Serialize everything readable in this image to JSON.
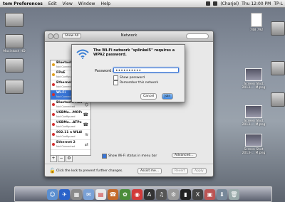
{
  "menubar": {
    "app": "tem Preferences",
    "items": [
      "Edit",
      "View",
      "Window",
      "Help"
    ],
    "user": "(Charjel)",
    "clock": "Thu 12:00 PM",
    "network_name": "TP-L"
  },
  "desktop": {
    "left_icons": [
      "Macintosh HD"
    ],
    "right_icons": [
      "748 792",
      "Screen Shot 2013-... M.png",
      "Screen Shot 2013-... M.png",
      "Screen Shot 2013-... M.png"
    ]
  },
  "window": {
    "title": "Network",
    "show_all": "Show All",
    "services": [
      {
        "name": "Bluetooth DUN",
        "status": "Not Connected",
        "color": "#e0a020"
      },
      {
        "name": "FPoE",
        "status": "Not Configured",
        "color": "#e0a020"
      },
      {
        "name": "Ethernet 1",
        "status": "Not Connected",
        "color": "#d33030"
      },
      {
        "name": "Wi-Fi",
        "status": "Not Connected",
        "color": "#d33030"
      },
      {
        "name": "Bluetooth PAN",
        "status": "Not Connected",
        "color": "#d33030"
      },
      {
        "name": "USBMo...MOPort",
        "status": "Not Configured",
        "color": "#d33030"
      },
      {
        "name": "USBMo...ATPort",
        "status": "Not Configured",
        "color": "#d33030"
      },
      {
        "name": "802.11 n WLAN",
        "status": "Not Configured",
        "color": "#d33030"
      },
      {
        "name": "Ethernet 2",
        "status": "Not Connected",
        "color": "#d33030"
      }
    ],
    "wifi_off_label": "n Off",
    "show_wifi_status": "Show Wi-Fi status in menu bar",
    "advanced": "Advanced...",
    "lock_text": "Click the lock to prevent further changes.",
    "assist": "Assist me...",
    "revert": "Revert",
    "apply": "Apply",
    "tool_add": "+",
    "tool_remove": "−",
    "tool_gear": "⚙"
  },
  "sheet": {
    "message": "The Wi-Fi network \"splinkel5\" requires a WPA2 password.",
    "password_label": "Password:",
    "password_value": "••••••••••",
    "show_password": "Show password",
    "remember": "Remember this network",
    "cancel": "Cancel",
    "join": "Join"
  },
  "colors": {
    "accent": "#3875d7"
  }
}
